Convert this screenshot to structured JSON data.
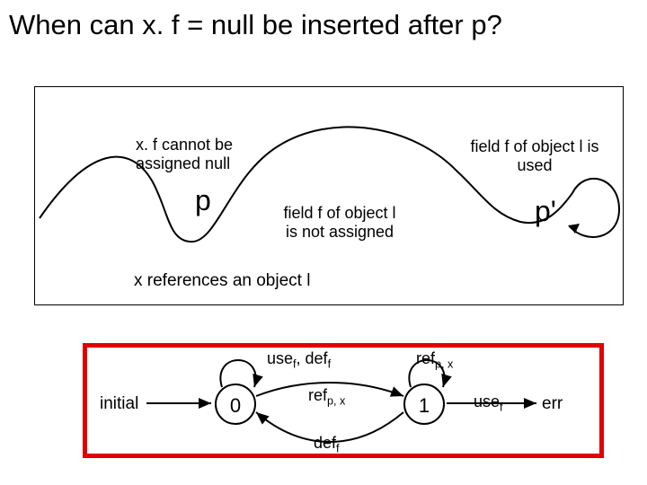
{
  "title": "When can x. f = null be inserted after p?",
  "upper": {
    "ann_left": "x. f cannot be\nassigned null",
    "p": "p",
    "ann_mid": "field f of object l\nis not assigned",
    "ann_right": "field f of object l is\nused",
    "pprime": "p'",
    "below": "x references an object l"
  },
  "lower": {
    "initial": "initial",
    "state0": "0",
    "state1": "1",
    "err": "err",
    "edge_initial_0": "",
    "edge_0_self_top_use": "use",
    "edge_0_self_top_def": ", def",
    "edge_0_1_ref": "ref",
    "edge_1_0_def": "def",
    "edge_1_self_ref": "ref",
    "edge_1_err_use": "use",
    "sub_f": "f",
    "sub_px": "p, x"
  }
}
